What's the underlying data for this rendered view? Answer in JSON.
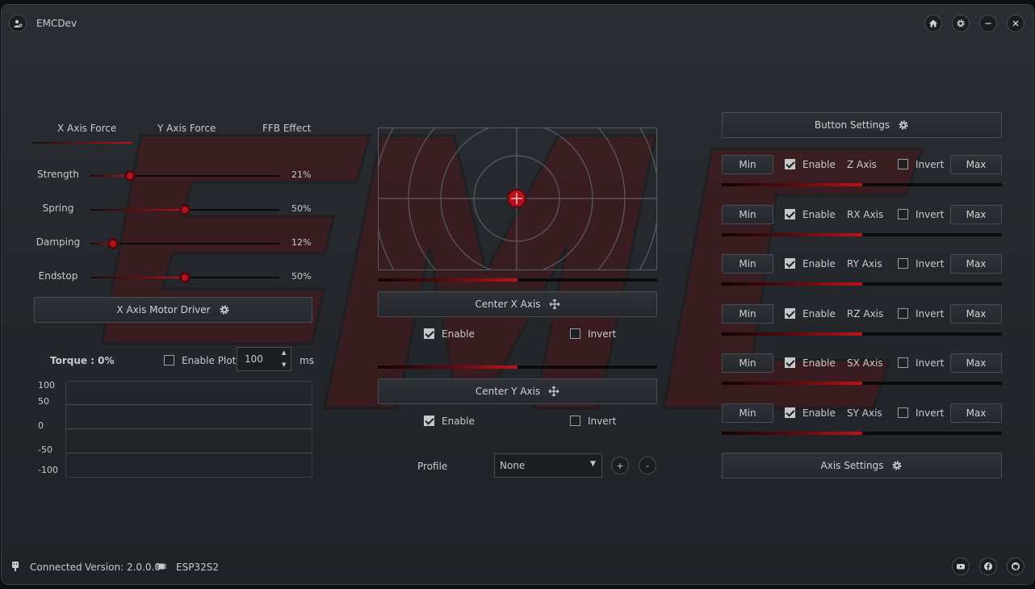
{
  "app": {
    "title": "EMCDev"
  },
  "tabs": [
    "X Axis Force",
    "Y Axis Force",
    "FFB Effect"
  ],
  "sliders": [
    {
      "label": "Strength",
      "value_text": "21%",
      "value": 0.21
    },
    {
      "label": "Spring",
      "value_text": "50%",
      "value": 0.5
    },
    {
      "label": "Damping",
      "value_text": "12%",
      "value": 0.12
    },
    {
      "label": "Endstop",
      "value_text": "50%",
      "value": 0.5
    }
  ],
  "motor_driver_button": "X Axis Motor Driver",
  "torque": {
    "label": "Torque : 0%",
    "enable_plot_label": "Enable Plot",
    "enable_plot_checked": false,
    "interval_value": "100",
    "interval_unit": "ms"
  },
  "plot": {
    "y_ticks": [
      "100",
      "50",
      "0",
      "-50",
      "-100"
    ]
  },
  "center": {
    "x_button": "Center X Axis",
    "y_button": "Center Y Axis",
    "x_progress": 0.5,
    "y_progress": 0.5,
    "x_enable_label": "Enable",
    "x_enable_checked": true,
    "x_invert_label": "Invert",
    "x_invert_checked": false,
    "y_enable_label": "Enable",
    "y_enable_checked": true,
    "y_invert_label": "Invert",
    "y_invert_checked": false
  },
  "profile": {
    "label": "Profile",
    "selected": "None",
    "add_label": "+",
    "remove_label": "-"
  },
  "button_settings": "Button Settings",
  "axis_settings": "Axis Settings",
  "axes": [
    {
      "name": "Z Axis",
      "min_label": "Min",
      "max_label": "Max",
      "enable_label": "Enable",
      "enable_checked": true,
      "invert_label": "Invert",
      "invert_checked": false,
      "level": 0.5
    },
    {
      "name": "RX Axis",
      "min_label": "Min",
      "max_label": "Max",
      "enable_label": "Enable",
      "enable_checked": true,
      "invert_label": "Invert",
      "invert_checked": false,
      "level": 0.5
    },
    {
      "name": "RY Axis",
      "min_label": "Min",
      "max_label": "Max",
      "enable_label": "Enable",
      "enable_checked": true,
      "invert_label": "Invert",
      "invert_checked": false,
      "level": 0.5
    },
    {
      "name": "RZ Axis",
      "min_label": "Min",
      "max_label": "Max",
      "enable_label": "Enable",
      "enable_checked": true,
      "invert_label": "Invert",
      "invert_checked": false,
      "level": 0.5
    },
    {
      "name": "SX Axis",
      "min_label": "Min",
      "max_label": "Max",
      "enable_label": "Enable",
      "enable_checked": true,
      "invert_label": "Invert",
      "invert_checked": false,
      "level": 0.5
    },
    {
      "name": "SY Axis",
      "min_label": "Min",
      "max_label": "Max",
      "enable_label": "Enable",
      "enable_checked": true,
      "invert_label": "Invert",
      "invert_checked": false,
      "level": 0.5
    }
  ],
  "status": {
    "connection": "Connected",
    "version": "Version: 2.0.0.0",
    "device": "ESP32S2"
  },
  "colors": {
    "accent": "#c0121b",
    "background": "#25282c",
    "border": "#4a4d52"
  },
  "icons": {
    "app": "app-logo-icon",
    "home": "home-icon",
    "settings": "gear-icon",
    "minimize": "minimize-icon",
    "close": "close-icon",
    "usb": "usb-plug-icon",
    "chip": "chip-icon",
    "youtube": "youtube-icon",
    "facebook": "facebook-icon",
    "github": "github-icon",
    "center": "move-arrows-icon"
  }
}
